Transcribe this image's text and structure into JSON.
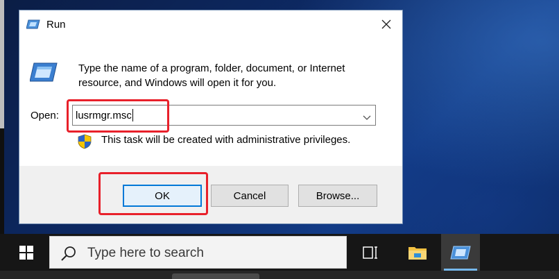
{
  "dialog": {
    "title": "Run",
    "description": "Type the name of a program, folder, document, or Internet resource, and Windows will open it for you.",
    "open_label": "Open:",
    "input_value": "lusrmgr.msc",
    "admin_note": "This task will be created with administrative privileges.",
    "buttons": {
      "ok": "OK",
      "cancel": "Cancel",
      "browse": "Browse..."
    }
  },
  "taskbar": {
    "search_placeholder": "Type here to search",
    "items": [
      "task-view-icon",
      "file-explorer-icon",
      "run-icon"
    ]
  },
  "colors": {
    "accent": "#0078d7",
    "annotation": "#e8202a",
    "taskbar": "#161616"
  }
}
